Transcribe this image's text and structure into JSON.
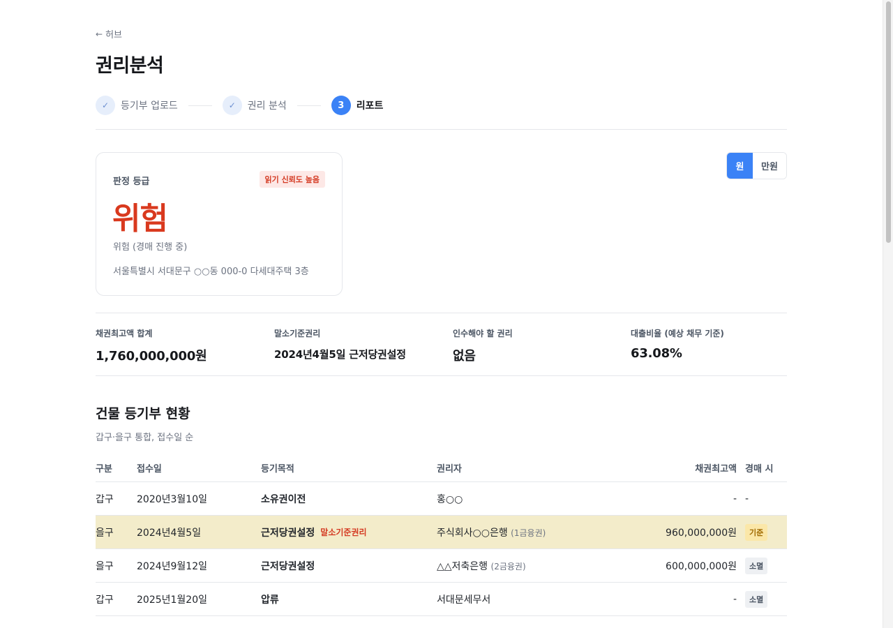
{
  "nav": {
    "back_arrow": "←",
    "back_label": "허브"
  },
  "page_title": "권리분석",
  "stepper": {
    "steps": [
      {
        "marker": "✓",
        "label": "등기부 업로드",
        "state": "done"
      },
      {
        "marker": "✓",
        "label": "권리 분석",
        "state": "done"
      },
      {
        "marker": "3",
        "label": "리포트",
        "state": "active"
      }
    ]
  },
  "grade_card": {
    "label": "판정 등급",
    "confidence_badge": "읽기 신뢰도 높음",
    "grade": "위험",
    "grade_desc": "위험 (경매 진행 중)",
    "address": "서울특별시 서대문구 ○○동 000-0 다세대주택 3층"
  },
  "unit_toggle": {
    "options": [
      "원",
      "만원"
    ],
    "selected": "원"
  },
  "summary": [
    {
      "label": "채권최고액 합계",
      "value": "1,760,000,000원"
    },
    {
      "label": "말소기준권리",
      "value": "2024년4월5일 근저당권설정"
    },
    {
      "label": "인수해야 할 권리",
      "value": "없음"
    },
    {
      "label": "대출비율 (예상 채무 기준)",
      "value": "63.08%"
    }
  ],
  "register_section": {
    "title": "건물 등기부 현황",
    "subtitle": "갑구·을구 통합, 접수일 순",
    "columns": [
      "구분",
      "접수일",
      "등기목적",
      "권리자",
      "채권최고액",
      "경매 시"
    ],
    "rows": [
      {
        "section": "갑구",
        "date": "2020년3월10일",
        "purpose": "소유권이전",
        "tag": "",
        "holder": "홍○○",
        "holder_sub": "",
        "amount": "-",
        "auction": "-",
        "auction_type": "none",
        "highlight": false
      },
      {
        "section": "을구",
        "date": "2024년4월5일",
        "purpose": "근저당권설정",
        "tag": "말소기준권리",
        "holder": "주식회사○○은행",
        "holder_sub": "(1금융권)",
        "amount": "960,000,000원",
        "auction": "기준",
        "auction_type": "base",
        "highlight": true
      },
      {
        "section": "을구",
        "date": "2024년9월12일",
        "purpose": "근저당권설정",
        "tag": "",
        "holder": "△△저축은행",
        "holder_sub": "(2금융권)",
        "amount": "600,000,000원",
        "auction": "소멸",
        "auction_type": "gone",
        "highlight": false
      },
      {
        "section": "갑구",
        "date": "2025년1월20일",
        "purpose": "압류",
        "tag": "",
        "holder": "서대문세무서",
        "holder_sub": "",
        "amount": "-",
        "auction": "소멸",
        "auction_type": "gone",
        "highlight": false
      }
    ]
  },
  "colors": {
    "accent": "#3b82f6",
    "danger": "#d9391e",
    "highlight_row": "#f3ecca"
  }
}
